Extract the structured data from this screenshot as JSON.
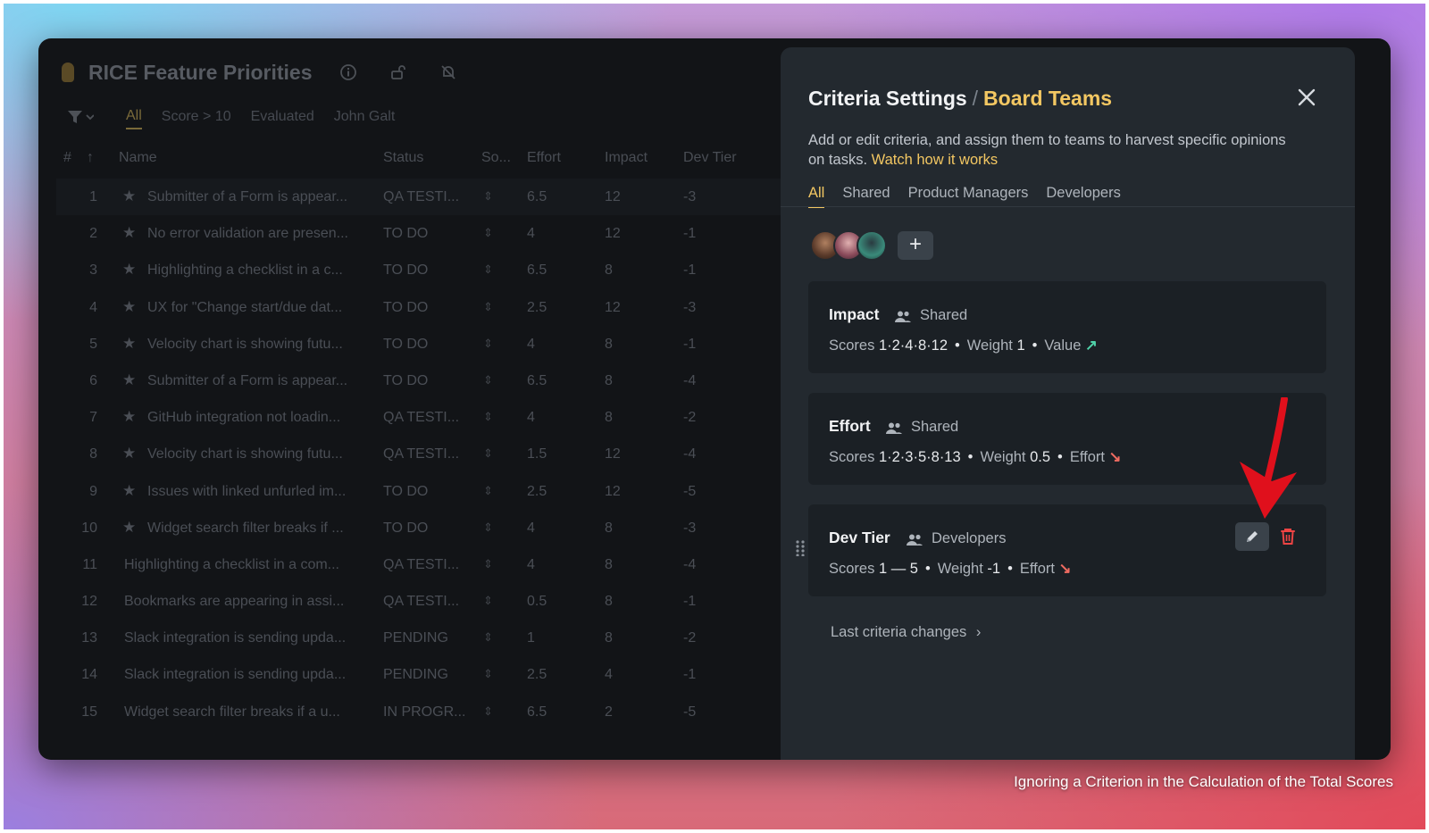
{
  "caption": "Ignoring a Criterion in the Calculation of the Total Scores",
  "board": {
    "title": "RICE Feature Priorities",
    "filters": [
      "All",
      "Score > 10",
      "Evaluated",
      "John Galt"
    ],
    "columns": {
      "num": "#",
      "name": "Name",
      "status": "Status",
      "score": "So...",
      "effort": "Effort",
      "impact": "Impact",
      "devtier": "Dev Tier"
    },
    "rows": [
      {
        "n": "1",
        "name": "Submitter of a Form is appear...",
        "status": "QA TESTI...",
        "effort": "6.5",
        "impact": "12",
        "devtier": "-3",
        "star": true
      },
      {
        "n": "2",
        "name": "No error validation are presen...",
        "status": "TO DO",
        "effort": "4",
        "impact": "12",
        "devtier": "-1",
        "star": true
      },
      {
        "n": "3",
        "name": "Highlighting a checklist in a c...",
        "status": "TO DO",
        "effort": "6.5",
        "impact": "8",
        "devtier": "-1",
        "star": true
      },
      {
        "n": "4",
        "name": "UX for \"Change start/due dat...",
        "status": "TO DO",
        "effort": "2.5",
        "impact": "12",
        "devtier": "-3",
        "star": true
      },
      {
        "n": "5",
        "name": "Velocity chart is showing futu...",
        "status": "TO DO",
        "effort": "4",
        "impact": "8",
        "devtier": "-1",
        "star": true
      },
      {
        "n": "6",
        "name": "Submitter of a Form is appear...",
        "status": "TO DO",
        "effort": "6.5",
        "impact": "8",
        "devtier": "-4",
        "star": true
      },
      {
        "n": "7",
        "name": "GitHub integration not loadin...",
        "status": "QA TESTI...",
        "effort": "4",
        "impact": "8",
        "devtier": "-2",
        "star": true
      },
      {
        "n": "8",
        "name": "Velocity chart is showing futu...",
        "status": "QA TESTI...",
        "effort": "1.5",
        "impact": "12",
        "devtier": "-4",
        "star": true
      },
      {
        "n": "9",
        "name": "Issues with linked unfurled im...",
        "status": "TO DO",
        "effort": "2.5",
        "impact": "12",
        "devtier": "-5",
        "star": true
      },
      {
        "n": "10",
        "name": "Widget search filter breaks if ...",
        "status": "TO DO",
        "effort": "4",
        "impact": "8",
        "devtier": "-3",
        "star": true
      },
      {
        "n": "11",
        "name": "Highlighting a checklist in a com...",
        "status": "QA TESTI...",
        "effort": "4",
        "impact": "8",
        "devtier": "-4",
        "star": false
      },
      {
        "n": "12",
        "name": "Bookmarks are appearing in assi...",
        "status": "QA TESTI...",
        "effort": "0.5",
        "impact": "8",
        "devtier": "-1",
        "star": false
      },
      {
        "n": "13",
        "name": "Slack integration is sending upda...",
        "status": "PENDING",
        "effort": "1",
        "impact": "8",
        "devtier": "-2",
        "star": false
      },
      {
        "n": "14",
        "name": "Slack integration is sending upda...",
        "status": "PENDING",
        "effort": "2.5",
        "impact": "4",
        "devtier": "-1",
        "star": false
      },
      {
        "n": "15",
        "name": "Widget search filter breaks if a u...",
        "status": "IN PROGR...",
        "effort": "6.5",
        "impact": "2",
        "devtier": "-5",
        "star": false
      }
    ]
  },
  "panel": {
    "title": "Criteria Settings",
    "separator": "/",
    "team": "Board Teams",
    "description": "Add or edit criteria, and assign them to teams to harvest specific opinions on tasks.",
    "watch_link": "Watch how it works",
    "tabs": [
      "All",
      "Shared",
      "Product Managers",
      "Developers"
    ],
    "add_label": "+",
    "criteria": [
      {
        "name": "Impact",
        "team": "Shared",
        "scores_label": "Scores",
        "scores": "1·2·4·8·12",
        "weight_label": "Weight",
        "weight": "1",
        "kind": "Value",
        "direction": "up"
      },
      {
        "name": "Effort",
        "team": "Shared",
        "scores_label": "Scores",
        "scores": "1·2·3·5·8·13",
        "weight_label": "Weight",
        "weight": "0.5",
        "kind": "Effort",
        "direction": "down"
      },
      {
        "name": "Dev Tier",
        "team": "Developers",
        "scores_label": "Scores",
        "scores": "1 — 5",
        "weight_label": "Weight",
        "weight": "-1",
        "kind": "Effort",
        "direction": "down"
      }
    ],
    "last_changes": "Last criteria changes",
    "close_icon": "close-icon"
  },
  "colors": {
    "accent": "#f3c762",
    "value_up": "#4fd1a8",
    "effort_down": "#ef6b61",
    "trash": "#ef4444",
    "annotation_arrow": "#e0101c"
  }
}
